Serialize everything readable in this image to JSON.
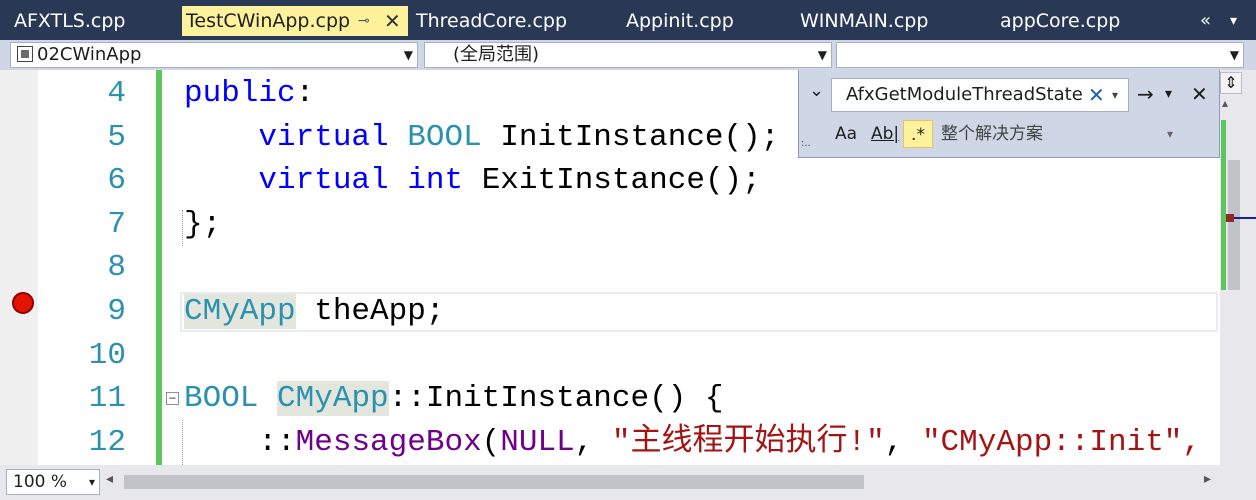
{
  "tabs": [
    {
      "label": "AFXTLS.cpp",
      "active": false
    },
    {
      "label": "TestCWinApp.cpp",
      "active": true
    },
    {
      "label": "ThreadCore.cpp",
      "active": false
    },
    {
      "label": "Appinit.cpp",
      "active": false
    },
    {
      "label": "WINMAIN.cpp",
      "active": false
    },
    {
      "label": "appCore.cpp",
      "active": false
    }
  ],
  "tab_pin_glyph": "⊸",
  "tab_close_glyph": "✕",
  "tab_overflow_glyph": "«",
  "tab_menu_glyph": "▾",
  "navbar": {
    "project": "02CWinApp",
    "scope": "(全局范围)",
    "member": ""
  },
  "editor": {
    "line_numbers": [
      "4",
      "5",
      "6",
      "7",
      "8",
      "9",
      "10",
      "11",
      "12"
    ],
    "breakpoint_line": "9",
    "collapse_glyph": "−",
    "tokens": {
      "l4_kw": "public",
      "l4_punc": ":",
      "l5_indent": "    ",
      "l5_kw": "virtual",
      "l5_ty": "BOOL",
      "l5_fn": "InitInstance",
      "l5_punc": "();",
      "l6_kw": "virtual",
      "l6_ty": "int",
      "l6_fn": "ExitInstance",
      "l6_punc": "();",
      "l7_punc": "};",
      "l9_cls": "CMyApp",
      "l9_rest": " theApp;",
      "l11_ty": "BOOL",
      "l11_cls": "CMyApp",
      "l11_sep": "::",
      "l11_fn": "InitInstance",
      "l11_punc": "() {",
      "l12_sep": "::",
      "l12_fn": "MessageBox",
      "l12_open": "(",
      "l12_macro": "NULL",
      "l12_comma": ", ",
      "l12_str1": "\"主线程开始执行!\"",
      "l12_comma2": ", ",
      "l12_str2": "\"CMyApp::Init\","
    }
  },
  "find_widget": {
    "expander": "⌄",
    "search_text": "AfxGetModuleThreadState",
    "clear_glyph": "✕",
    "dropdown_glyph": "▾",
    "find_next_glyph": "→",
    "options_glyph": "▾",
    "close_glyph": "✕",
    "match_case": "Aa",
    "whole_word": "Ab|",
    "regex": ".*",
    "scope": "整个解决方案",
    "scope_arrow": "▾",
    "grip": ":.."
  },
  "scrollbar": {
    "split_glyph": "⇕",
    "up_glyph": "▴",
    "left_glyph": "◂",
    "right_glyph": "▸"
  },
  "zoom": "100 %",
  "zoom_arrow": "▾",
  "colors": {
    "chrome": "#293955",
    "active_tab": "#fff29d",
    "keyword": "#0000ff",
    "type": "#2b91af",
    "string": "#a31515",
    "macro": "#6f008a",
    "change_bar": "#5cc75c",
    "breakpoint": "#e51400"
  }
}
